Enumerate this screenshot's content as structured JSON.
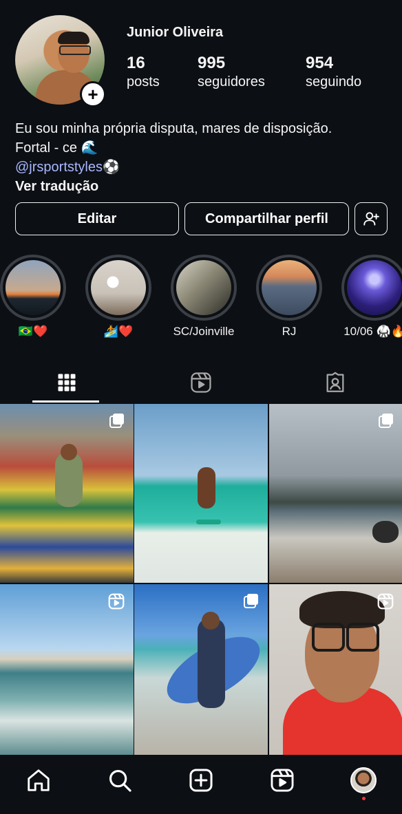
{
  "profile": {
    "username": "Junior Oliveira",
    "stats": [
      {
        "value": "16",
        "label": "posts"
      },
      {
        "value": "995",
        "label": "seguidores"
      },
      {
        "value": "954",
        "label": "seguindo"
      }
    ],
    "bio_line1": "Eu sou minha própria disputa, mares de disposição.",
    "bio_line2": "Fortal - ce 🌊",
    "bio_link": "@jrsportstyles⚽",
    "translate": "Ver tradução"
  },
  "buttons": {
    "edit": "Editar",
    "share": "Compartilhar perfil"
  },
  "highlights": [
    {
      "label": "🇧🇷❤️"
    },
    {
      "label": "🏄❤️"
    },
    {
      "label": "SC/Joinville"
    },
    {
      "label": "RJ"
    },
    {
      "label": "10/06 🥋🔥"
    }
  ],
  "colors": {
    "background": "#0c0f14",
    "link": "#a9b8ff",
    "notification_dot": "#ff3040"
  },
  "icons": [
    "add-icon",
    "add-person-icon",
    "grid-icon",
    "reels-icon",
    "tagged-icon",
    "carousel-icon",
    "home-icon",
    "search-icon",
    "create-icon",
    "profile-avatar"
  ]
}
